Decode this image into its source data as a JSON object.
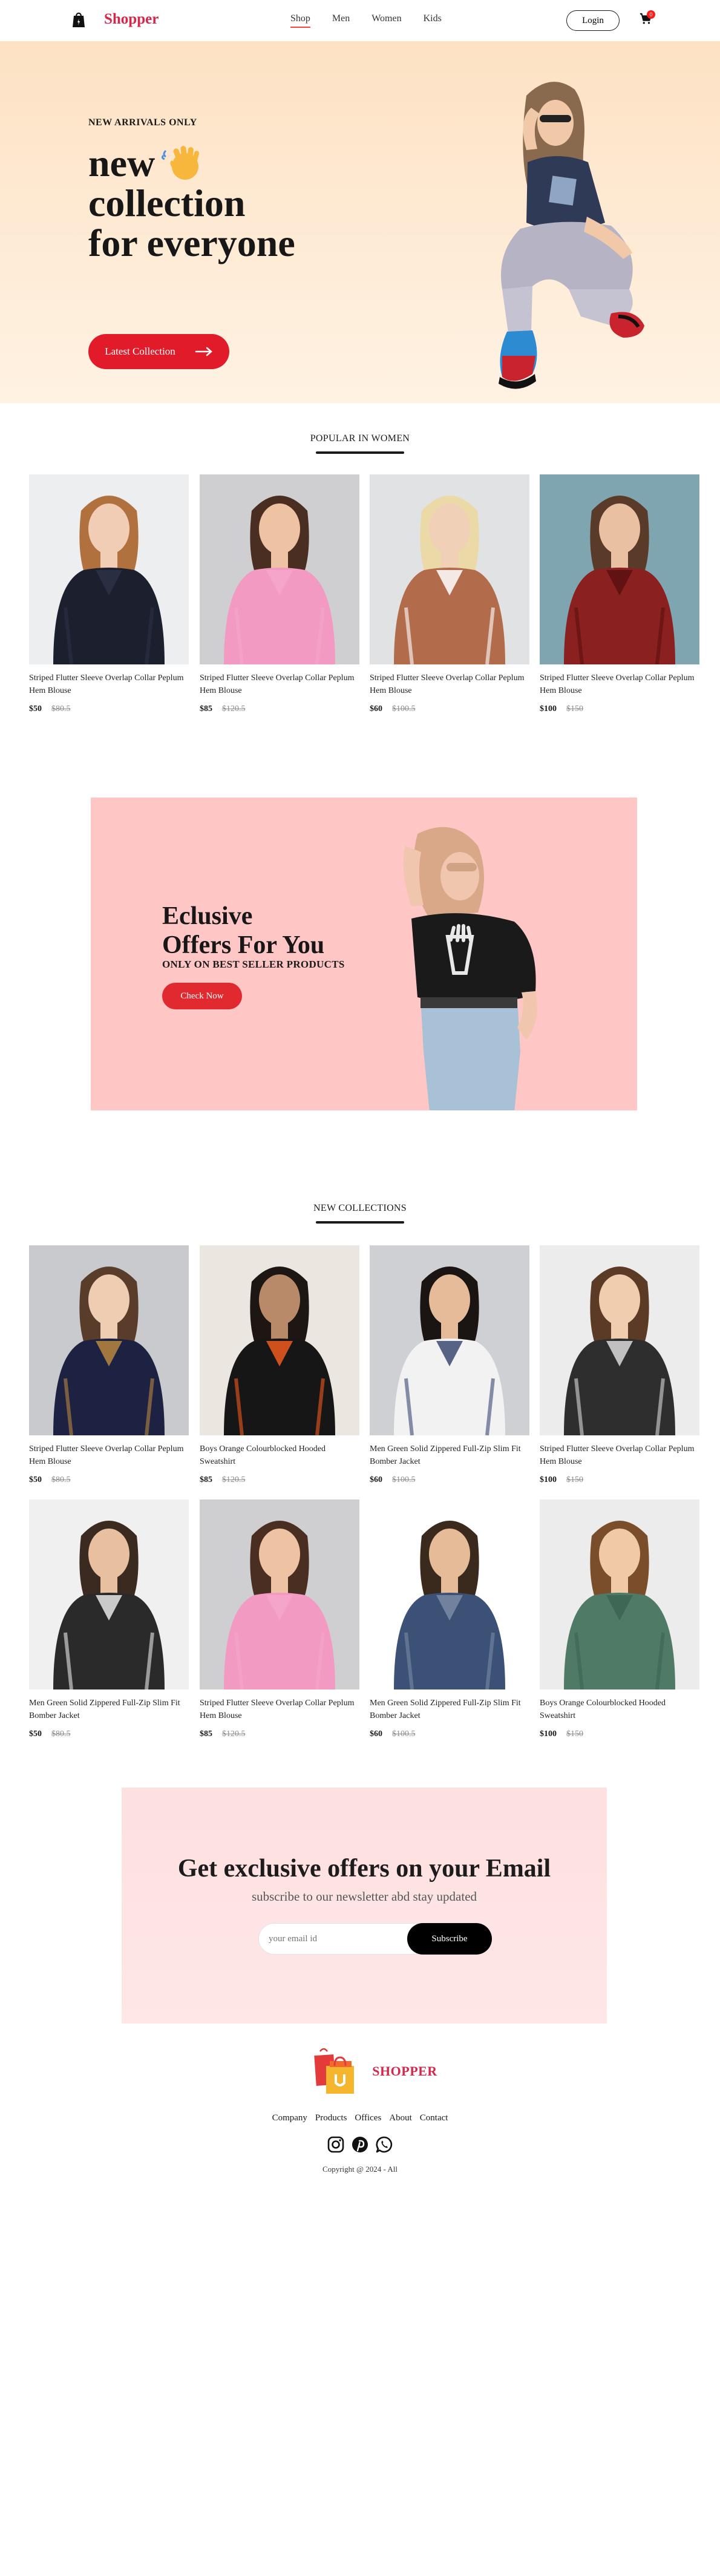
{
  "nav": {
    "brand": "Shopper",
    "menu": [
      "Shop",
      "Men",
      "Women",
      "Kids"
    ],
    "login": "Login",
    "cart_count": "0"
  },
  "hero": {
    "tag": "NEW ARRIVALS ONLY",
    "line1": "new",
    "line2": "collection",
    "line3": "for everyone",
    "button": "Latest Collection"
  },
  "popular": {
    "title": "POPULAR IN WOMEN",
    "items": [
      {
        "name": "Striped Flutter Sleeve Overlap Collar Peplum Hem Blouse",
        "new_price": "$50",
        "old_price": "$80.5",
        "photo": "woman-puffer-jacket"
      },
      {
        "name": "Striped Flutter Sleeve Overlap Collar Peplum Hem Blouse",
        "new_price": "$85",
        "old_price": "$120.5",
        "photo": "woman-pink-top"
      },
      {
        "name": "Striped Flutter Sleeve Overlap Collar Peplum Hem Blouse",
        "new_price": "$60",
        "old_price": "$100.5",
        "photo": "woman-crop-top"
      },
      {
        "name": "Striped Flutter Sleeve Overlap Collar Peplum Hem Blouse",
        "new_price": "$100",
        "old_price": "$150",
        "photo": "woman-red-dress"
      }
    ]
  },
  "offers": {
    "title_line1": "Eclusive",
    "title_line2": "Offers For You",
    "subtitle": "ONLY ON BEST SELLER PRODUCTS",
    "button": "Check Now"
  },
  "new_collections": {
    "title": "NEW COLLECTIONS",
    "items": [
      {
        "name": "Striped Flutter Sleeve Overlap Collar Peplum Hem Blouse",
        "new_price": "$50",
        "old_price": "$80.5",
        "photo": "woman-navy-sweater"
      },
      {
        "name": "Boys Orange Colourblocked Hooded Sweatshirt",
        "new_price": "$85",
        "old_price": "$120.5",
        "photo": "boy-track-jacket"
      },
      {
        "name": "Men Green Solid Zippered Full-Zip Slim Fit Bomber Jacket",
        "new_price": "$60",
        "old_price": "$100.5",
        "photo": "man-white-jacket"
      },
      {
        "name": "Striped Flutter Sleeve Overlap Collar Peplum Hem Blouse",
        "new_price": "$100",
        "old_price": "$150",
        "photo": "woman-floral-top"
      },
      {
        "name": "Men Green Solid Zippered Full-Zip Slim Fit Bomber Jacket",
        "new_price": "$50",
        "old_price": "$80.5",
        "photo": "man-camo-jacket"
      },
      {
        "name": "Striped Flutter Sleeve Overlap Collar Peplum Hem Blouse",
        "new_price": "$85",
        "old_price": "$120.5",
        "photo": "woman-pink-top"
      },
      {
        "name": "Men Green Solid Zippered Full-Zip Slim Fit Bomber Jacket",
        "new_price": "$60",
        "old_price": "$100.5",
        "photo": "man-denim-jacket"
      },
      {
        "name": "Boys Orange Colourblocked Hooded Sweatshirt",
        "new_price": "$100",
        "old_price": "$150",
        "photo": "boy-green-sweatshirt"
      }
    ]
  },
  "newsletter": {
    "title": "Get exclusive offers on your Email",
    "subtitle": "subscribe to our newsletter abd stay updated",
    "placeholder": "your email id",
    "button": "Subscribe"
  },
  "footer": {
    "brand": "SHOPPER",
    "links": [
      "Company",
      "Products",
      "Offices",
      "About",
      "Contact"
    ],
    "social": [
      "instagram-icon",
      "pinterest-icon",
      "whatsapp-icon"
    ],
    "copyright": "Copyright @ 2024 - All"
  },
  "colors": {
    "brand_red": "#d6264a",
    "button_red": "#e21b2a",
    "hero_bg": "#fde2c4",
    "offers_bg": "#ffc6c6",
    "newsletter_bg": "#fde0e0"
  }
}
